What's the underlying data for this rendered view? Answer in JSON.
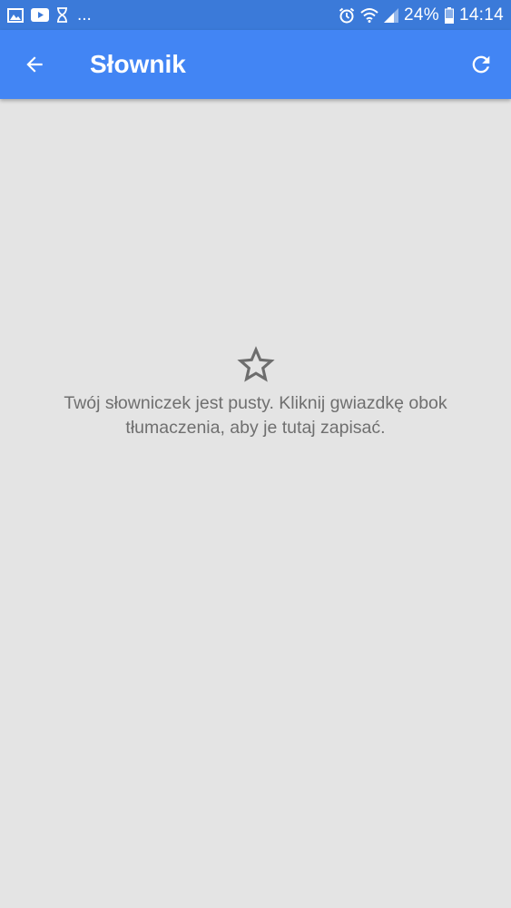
{
  "status_bar": {
    "dots": "...",
    "battery": "24%",
    "time": "14:14",
    "icons": [
      "image-icon",
      "youtube-icon",
      "hourglass-icon",
      "alarm-icon",
      "wifi-icon",
      "signal-icon",
      "battery-icon"
    ]
  },
  "app_bar": {
    "title": "Słownik",
    "back_icon": "arrow-back-icon",
    "refresh_icon": "refresh-icon",
    "background": "#4285f4"
  },
  "empty_state": {
    "icon": "star-outline-icon",
    "message": "Twój słowniczek jest pusty. Kliknij gwiazdkę obok tłumaczenia, aby je tutaj zapisać."
  },
  "colors": {
    "status_bar": "#3b7ad9",
    "app_bar": "#4285f4",
    "background": "#e4e4e4",
    "empty_text": "#6f6f6f"
  }
}
